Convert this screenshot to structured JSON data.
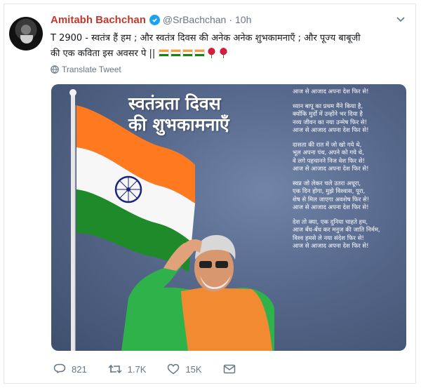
{
  "tweet": {
    "author_name": "Amitabh Bachchan",
    "handle": "@SrBachchan",
    "separator": "·",
    "time": "10h",
    "text_line1": "T 2900 - स्वतंत्र हैं हम ; और स्वतंत्र दिवस की अनेक अनेक शुभकामनाएँ  ; और पूज्य बाबूजी",
    "text_line2": "की एक कविता इस अवसर पे  ||",
    "translate_label": "Translate Tweet"
  },
  "media": {
    "title_line1": "स्वतंत्रता दिवस",
    "title_line2": "की शुभकामनाएँ",
    "poem_stanzas": [
      [
        "आज से आजाद अपना देश फिर से!"
      ],
      [
        "ध्यान बापू का प्रथम मैंने किया है,",
        "क्योंकि मुर्दों में उन्होंने भर दिया है",
        "नव्य जीवन का नया उन्मेष फिर से!",
        "आज से आजाद अपना देश फिर से!"
      ],
      [
        "दासता की रात में जो खो गये थे,",
        "भूल अपना पंथ, अपने को गये थे,",
        "वे लगे पहचानने निज वेश फिर से!",
        "आज से आजाद अपना देश फिर से!"
      ],
      [
        "स्वप्न जो लेकर चले उतरा अधूरा,",
        "एक दिन होगा, मुझे विश्वास, पूरा,",
        "शेष से मिल जाएगा अवशेष फिर से!",
        "आज से आजाद अपना देश फिर से!"
      ],
      [
        "देश तो क्या, एक दुनिया चाहते हम,",
        "आज बँध-बँध कर मनुज की जाति निर्मम,",
        "विश्व हमसे ले नया संदेश फिर से!",
        "आज से आजाद अपना देश फिर से!"
      ]
    ]
  },
  "actions": {
    "reply_count": "821",
    "retweet_count": "1.7K",
    "like_count": "15K"
  },
  "colors": {
    "name": "#c0392b",
    "muted": "#657786",
    "verified": "#1da1f2",
    "saffron": "#ff9933",
    "green": "#138808"
  },
  "icons": [
    "verified-badge-icon",
    "chevron-down-icon",
    "globe-icon",
    "reply-icon",
    "retweet-icon",
    "like-icon",
    "message-icon",
    "flag-emoji",
    "rose-emoji"
  ]
}
